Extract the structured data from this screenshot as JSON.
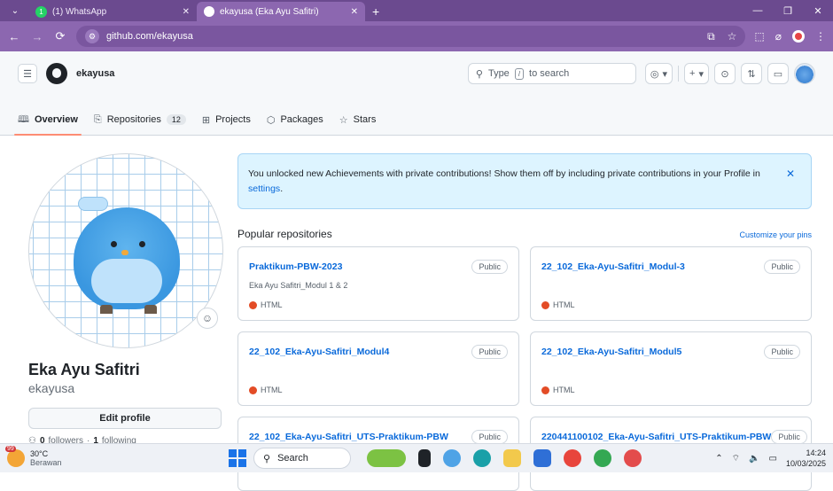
{
  "browser": {
    "tabs": [
      {
        "title": "(1) WhatsApp",
        "active": false,
        "badge": "1"
      },
      {
        "title": "ekayusa (Eka Ayu Safitri)",
        "active": true
      }
    ],
    "url": "github.com/ekayusa",
    "accent_color": "#8c67b0"
  },
  "header": {
    "username": "ekayusa",
    "search": {
      "prefix": "Type",
      "key": "/",
      "suffix": "to search"
    },
    "nav": [
      {
        "label": "Overview",
        "icon": "book-icon",
        "active": true
      },
      {
        "label": "Repositories",
        "icon": "repo-icon",
        "count": "12"
      },
      {
        "label": "Projects",
        "icon": "table-icon"
      },
      {
        "label": "Packages",
        "icon": "package-icon"
      },
      {
        "label": "Stars",
        "icon": "star-icon"
      }
    ]
  },
  "profile": {
    "name": "Eka Ayu Safitri",
    "login": "ekayusa",
    "edit_label": "Edit profile",
    "followers_count": "0",
    "followers_label": "followers",
    "following_count": "1",
    "following_label": "following"
  },
  "flash": {
    "message": "You unlocked new Achievements with private contributions! Show them off by including private contributions in your Profile in",
    "link": "settings",
    "end": "."
  },
  "popular": {
    "title": "Popular repositories",
    "customize": "Customize your pins",
    "repos": [
      {
        "name": "Praktikum-PBW-2023",
        "visibility": "Public",
        "description": "Eka Ayu Safitri_Modul 1 & 2",
        "language": "HTML",
        "lang_color": "#e34c26"
      },
      {
        "name": "22_102_Eka-Ayu-Safitri_Modul-3",
        "visibility": "Public",
        "description": "",
        "language": "HTML",
        "lang_color": "#e34c26"
      },
      {
        "name": "22_102_Eka-Ayu-Safitri_Modul4",
        "visibility": "Public",
        "description": "",
        "language": "HTML",
        "lang_color": "#e34c26"
      },
      {
        "name": "22_102_Eka-Ayu-Safitri_Modul5",
        "visibility": "Public",
        "description": "",
        "language": "HTML",
        "lang_color": "#e34c26"
      },
      {
        "name": "22_102_Eka-Ayu-Safitri_UTS-Praktikum-PBW",
        "visibility": "Public",
        "description": "",
        "language": "",
        "lang_color": "#e34c26"
      },
      {
        "name": "220441100102_Eka-Ayu-Safitri_UTS-Praktikum-PBW",
        "visibility": "Public",
        "description": "",
        "language": "",
        "lang_color": "#e34c26"
      }
    ]
  },
  "taskbar": {
    "weather_temp": "30°C",
    "weather_desc": "Berawan",
    "weather_badge": "99",
    "search_label": "Search",
    "time": "14:24",
    "date": "10/03/2025"
  }
}
